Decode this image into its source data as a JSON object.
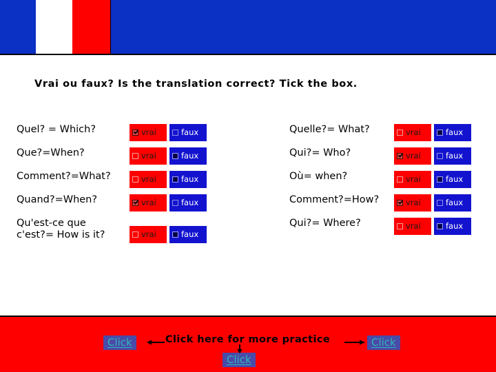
{
  "header": {
    "flag_name": "french-flag",
    "colors": {
      "blue": "#0b30c4",
      "white": "#ffffff",
      "red": "#fe0000"
    }
  },
  "instruction": "Vrai ou faux? Is the translation correct? Tick the box.",
  "answer_labels": {
    "vrai": "vrai",
    "faux": "faux"
  },
  "quiz": {
    "left_column": [
      {
        "question": "Quel? = Which?",
        "vrai_checked": true,
        "faux_checked": false
      },
      {
        "question": "Que?=When?",
        "vrai_checked": false,
        "faux_checked": true
      },
      {
        "question": "Comment?=What?",
        "vrai_checked": false,
        "faux_checked": true
      },
      {
        "question": "Quand?=When?",
        "vrai_checked": true,
        "faux_checked": false
      },
      {
        "question": "Qu'est-ce que\nc'est?= How is it?",
        "vrai_checked": false,
        "faux_checked": true
      }
    ],
    "right_column": [
      {
        "question": "Quelle?= What?",
        "vrai_checked": false,
        "faux_checked": true
      },
      {
        "question": "Qui?= Who?",
        "vrai_checked": true,
        "faux_checked": false
      },
      {
        "question": "Où= when?",
        "vrai_checked": false,
        "faux_checked": true
      },
      {
        "question": "Comment?=How?",
        "vrai_checked": true,
        "faux_checked": false
      },
      {
        "question": "Qui?= Where?",
        "vrai_checked": false,
        "faux_checked": true
      }
    ]
  },
  "footer": {
    "text": "Click here for more practice",
    "click_left": "Click",
    "click_middle": "Click",
    "click_right": "Click",
    "background": "#fe0000",
    "link_color": "#2fb8b8",
    "link_background": "#4a4aa8"
  }
}
